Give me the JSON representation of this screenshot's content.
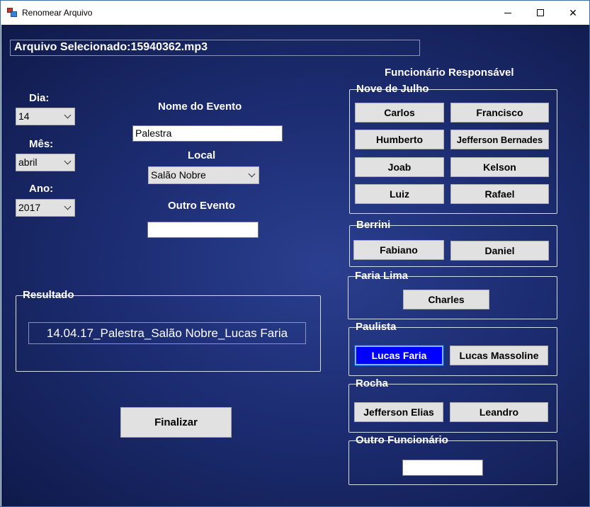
{
  "window": {
    "title": "Renomear Arquivo",
    "controls": {
      "minimize": "─",
      "maximize": "☐",
      "close": "✕"
    }
  },
  "file": {
    "label": "Arquivo Selecionado:",
    "name": "15940362.mp3"
  },
  "date": {
    "day_label": "Dia:",
    "day_value": "14",
    "month_label": "Mês:",
    "month_value": "abril",
    "year_label": "Ano:",
    "year_value": "2017"
  },
  "event": {
    "name_label": "Nome do Evento",
    "name_value": "Palestra",
    "location_label": "Local",
    "location_value": "Salão Nobre",
    "other_label": "Outro Evento",
    "other_value": ""
  },
  "result": {
    "title": "Resultado",
    "value": "14.04.17_Palestra_Salão Nobre_Lucas Faria"
  },
  "finalize_label": "Finalizar",
  "responsible": {
    "title": "Funcionário Responsável",
    "groups": [
      {
        "name": "Nove de Julho",
        "buttons": [
          "Carlos",
          "Francisco",
          "Humberto",
          "Jefferson Bernades",
          "Joab",
          "Kelson",
          "Luiz",
          "Rafael"
        ]
      },
      {
        "name": "Berrini",
        "buttons": [
          "Fabiano",
          "Daniel"
        ]
      },
      {
        "name": "Faria Lima",
        "buttons": [
          "Charles"
        ]
      },
      {
        "name": "Paulista",
        "buttons": [
          "Lucas Faria",
          "Lucas Massoline"
        ],
        "selected": "Lucas Faria"
      },
      {
        "name": "Rocha",
        "buttons": [
          "Jefferson Elias",
          "Leandro"
        ]
      }
    ],
    "other_label": "Outro Funcionário",
    "other_value": ""
  },
  "colors": {
    "selected_button": "#0000ff",
    "client_background": "#1d2d73"
  }
}
